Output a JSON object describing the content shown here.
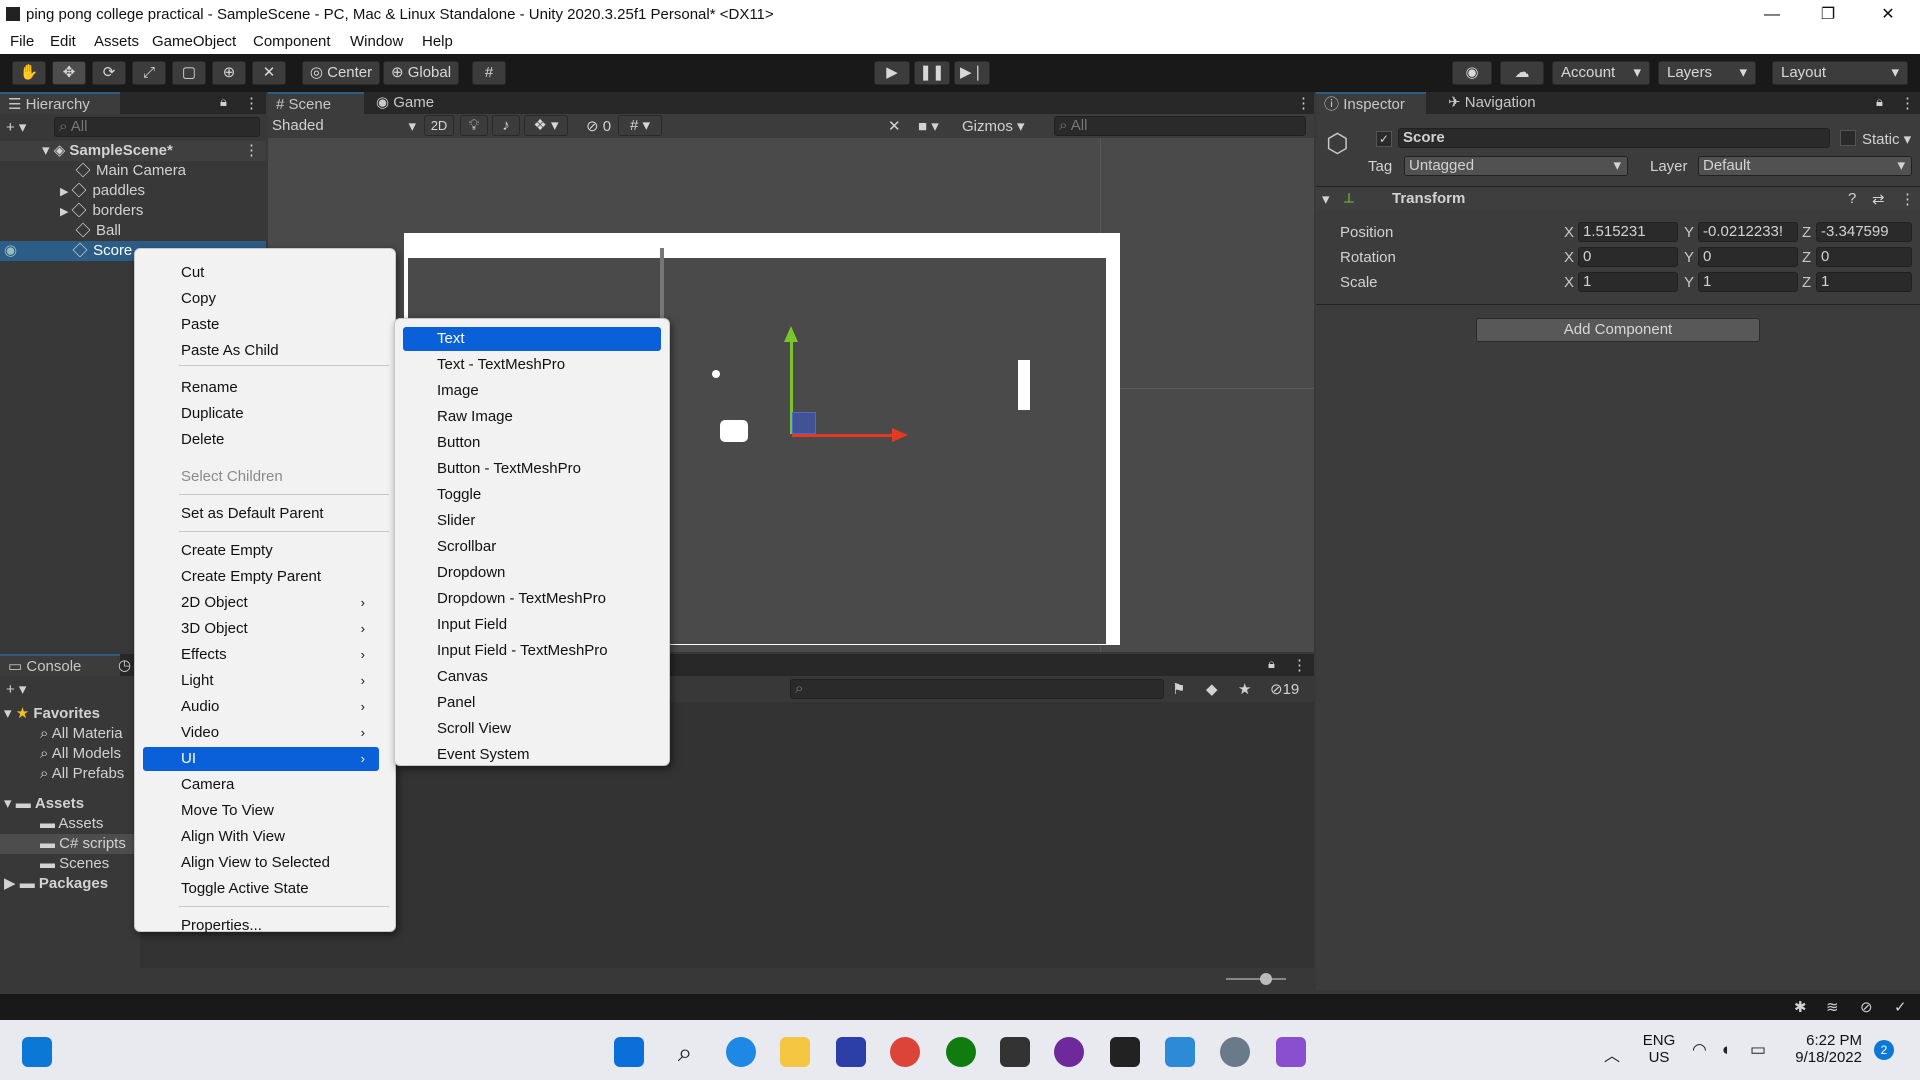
{
  "window": {
    "title": "ping pong college practical - SampleScene - PC, Mac & Linux Standalone - Unity 2020.3.25f1 Personal* <DX11>",
    "minimize": "—",
    "maximize": "❐",
    "close": "✕"
  },
  "menu": [
    "File",
    "Edit",
    "Assets",
    "GameObject",
    "Component",
    "Window",
    "Help"
  ],
  "toolbar": {
    "pivot": "Center",
    "space": "Global",
    "account": "Account",
    "layers": "Layers",
    "layout": "Layout"
  },
  "hierarchy": {
    "tab": "Hierarchy",
    "search_placeholder": "All",
    "scene": "SampleScene*",
    "items": [
      "Main Camera",
      "paddles",
      "borders",
      "Ball",
      "Score"
    ]
  },
  "scene_view": {
    "tabs": [
      "Scene",
      "Game"
    ],
    "shading": "Shaded",
    "mode_2d": "2D",
    "hidden_count": "0",
    "gizmos": "Gizmos",
    "search_placeholder": "All"
  },
  "inspector": {
    "tabs": [
      "Inspector",
      "Navigation"
    ],
    "object_name": "Score",
    "static_label": "Static",
    "tag_label": "Tag",
    "tag_value": "Untagged",
    "layer_label": "Layer",
    "layer_value": "Default",
    "component": "Transform",
    "position_label": "Position",
    "rotation_label": "Rotation",
    "scale_label": "Scale",
    "axis_x": "X",
    "axis_y": "Y",
    "axis_z": "Z",
    "position": [
      "1.515231",
      "-0.0212233!",
      "-3.347599"
    ],
    "rotation": [
      "0",
      "0",
      "0"
    ],
    "scale": [
      "1",
      "1",
      "1"
    ],
    "add_component": "Add Component"
  },
  "console": {
    "tab": "Console",
    "hidden_count": "19"
  },
  "project": {
    "favorites": "Favorites",
    "fav_items": [
      "All Materia",
      "All Models",
      "All Prefabs"
    ],
    "assets": "Assets",
    "asset_items": [
      "Assets",
      "C# scripts",
      "Scenes"
    ],
    "packages": "Packages"
  },
  "context_menu": {
    "items": [
      {
        "label": "Cut"
      },
      {
        "label": "Copy"
      },
      {
        "label": "Paste"
      },
      {
        "label": "Paste As Child"
      },
      {
        "label": "Rename"
      },
      {
        "label": "Duplicate"
      },
      {
        "label": "Delete"
      },
      {
        "label": "Select Children"
      },
      {
        "label": "Set as Default Parent"
      },
      {
        "label": "Create Empty"
      },
      {
        "label": "Create Empty Parent"
      },
      {
        "label": "2D Object"
      },
      {
        "label": "3D Object"
      },
      {
        "label": "Effects"
      },
      {
        "label": "Light"
      },
      {
        "label": "Audio"
      },
      {
        "label": "Video"
      },
      {
        "label": "UI"
      },
      {
        "label": "Camera"
      },
      {
        "label": "Move To View"
      },
      {
        "label": "Align With View"
      },
      {
        "label": "Align View to Selected"
      },
      {
        "label": "Toggle Active State"
      },
      {
        "label": "Properties..."
      }
    ],
    "submenu_arrow": "›"
  },
  "ui_submenu": {
    "items": [
      "Text",
      "Text - TextMeshPro",
      "Image",
      "Raw Image",
      "Button",
      "Button - TextMeshPro",
      "Toggle",
      "Slider",
      "Scrollbar",
      "Dropdown",
      "Dropdown - TextMeshPro",
      "Input Field",
      "Input Field - TextMeshPro",
      "Canvas",
      "Panel",
      "Scroll View",
      "Event System"
    ]
  },
  "taskbar": {
    "lang1": "ENG",
    "lang2": "US",
    "time": "6:22 PM",
    "date": "9/18/2022",
    "notifications": "2"
  }
}
